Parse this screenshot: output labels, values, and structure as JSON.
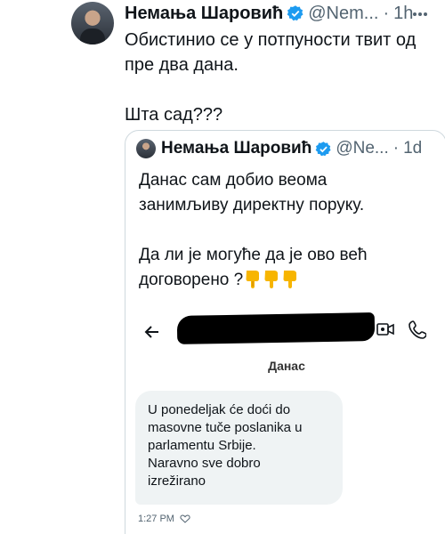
{
  "tweet": {
    "author_name": "Немања Шаровић",
    "handle": "@Nem...",
    "separator": "·",
    "time": "1h",
    "text": "Обистинио се у потпуности твит од\nпре два дана.\n\nШта сад???"
  },
  "quoted_tweet": {
    "author_name": "Немања Шаровић",
    "handle": "@Ne...",
    "separator": "·",
    "time": "1d",
    "text": "Данас сам добио веома\nзанимљиву директну поруку.\n\nДа ли је могуће да је ово већ\nдоговорено ?",
    "emoji": [
      "pointing-down",
      "pointing-down",
      "pointing-down"
    ]
  },
  "dm_screenshot": {
    "date_separator": "Данас",
    "message": "U ponedeljak će doći do\nmasovne tuče poslanika u\nparlamentu Srbije.\nNaravno sve dobro\nizrežirano",
    "timestamp": "1:27 PM"
  },
  "colors": {
    "verified": "#1d9bf0",
    "secondary_text": "#536471",
    "border": "#cfd9de",
    "bubble": "#eff3f4",
    "emoji": "#f7b500"
  }
}
